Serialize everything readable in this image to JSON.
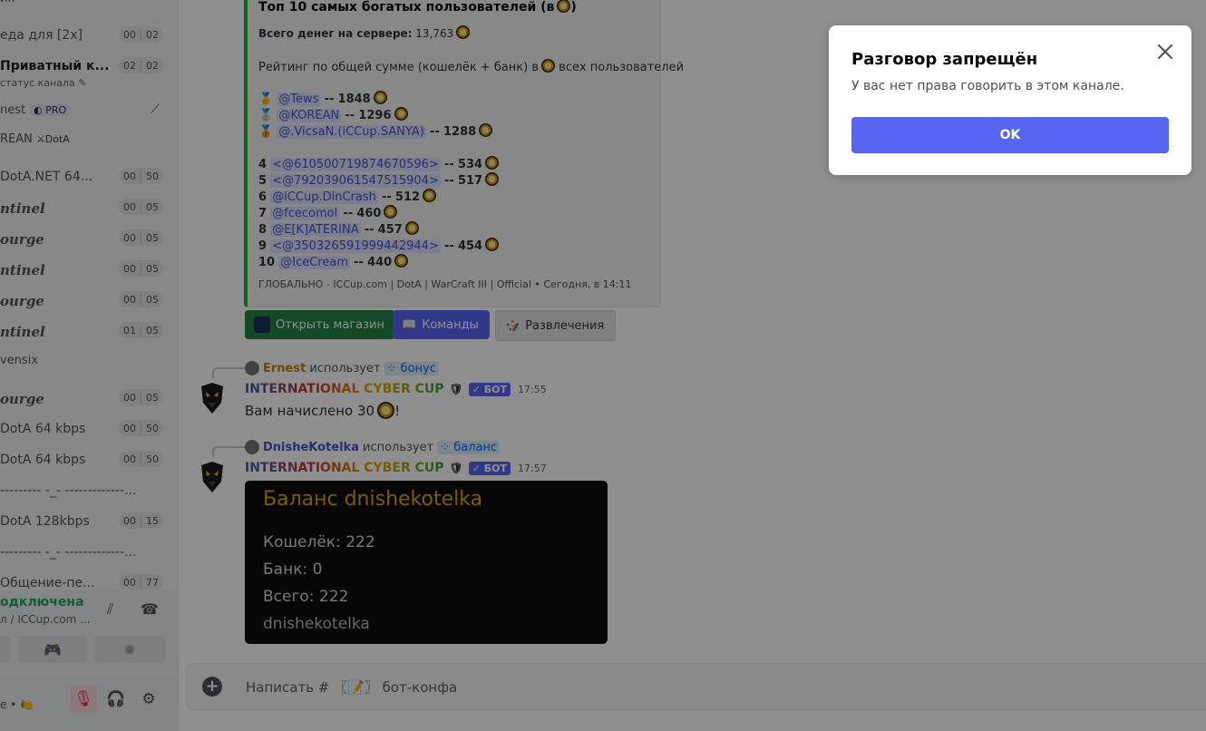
{
  "sidebar": {
    "top_clip": "ик",
    "channels": [
      {
        "name": "еда для [2x]",
        "left": "00",
        "right": "02",
        "style": "normal"
      },
      {
        "name": "Приватный к...",
        "left": "02",
        "right": "02",
        "style": "bold",
        "sub": "статус канала"
      },
      {
        "name": "DotA.NET 64...",
        "left": "00",
        "right": "50",
        "style": "normal"
      },
      {
        "name": "ntinel",
        "left": "00",
        "right": "05",
        "style": "gothic"
      },
      {
        "name": "ourge",
        "left": "00",
        "right": "05",
        "style": "gothic"
      },
      {
        "name": "ntinel",
        "left": "00",
        "right": "05",
        "style": "gothic"
      },
      {
        "name": "ourge",
        "left": "00",
        "right": "05",
        "style": "gothic"
      },
      {
        "name": "ntinel",
        "left": "01",
        "right": "05",
        "style": "gothic"
      },
      {
        "name": "ourge",
        "left": "00",
        "right": "05",
        "style": "gothic"
      },
      {
        "name": "DotA 64 kbps",
        "left": "00",
        "right": "50",
        "style": "normal"
      },
      {
        "name": "DotA 64 kbps",
        "left": "00",
        "right": "50",
        "style": "normal"
      },
      {
        "name": "--------- -_- -------------...",
        "style": "divider"
      },
      {
        "name": "DotA 128kbps",
        "left": "00",
        "right": "15",
        "style": "normal"
      },
      {
        "name": "--------- -_- -------------...",
        "style": "divider"
      },
      {
        "name": "Общение-пе...",
        "left": "00",
        "right": "77",
        "style": "normal"
      }
    ],
    "users": [
      {
        "name": "nest",
        "tag": "PRO"
      },
      {
        "name": "REAN",
        "tag": "DotA"
      },
      {
        "name": "vensix",
        "tag": ""
      }
    ],
    "voice": {
      "status": "одключена",
      "where": "л / ICCup.com ..."
    },
    "user_status": "е •"
  },
  "embed": {
    "title": "Топ 10 самых богатых пользователей (в",
    "title_end": ")",
    "total_label": "Всего денег на сервере:",
    "total_value": "13,763",
    "desc_prefix": "Рейтинг по общей сумме (кошелёк + банк) в",
    "desc_suffix": "всех пользователей",
    "top3": [
      {
        "name": "@Tews",
        "sep": "--",
        "value": "1848"
      },
      {
        "name": "@KOREAN",
        "sep": "--",
        "value": "1296"
      },
      {
        "name": "@.VicsaN.(iCCup.SANYA)",
        "sep": "--",
        "value": "1288"
      }
    ],
    "rest": [
      {
        "rank": "4",
        "name": "<@610500719874670596>",
        "sep": "--",
        "value": "534"
      },
      {
        "rank": "5",
        "name": "<@792039061547515904>",
        "sep": "--",
        "value": "517"
      },
      {
        "rank": "6",
        "name": "@iCCup.DinCrash",
        "sep": "--",
        "value": "512"
      },
      {
        "rank": "7",
        "name": "@fcecomol",
        "sep": "--",
        "value": "460"
      },
      {
        "rank": "8",
        "name": "@E[K]ATERINA",
        "sep": "--",
        "value": "457"
      },
      {
        "rank": "9",
        "name": "<@350326591999442944>",
        "sep": "--",
        "value": "454"
      },
      {
        "rank": "10",
        "name": "@IceCream",
        "sep": "--",
        "value": "440"
      }
    ],
    "footer": "ГЛОБАЛЬНО - ICCup.com | DotA | WarCraft III | Official • Сегодня, в 14:11"
  },
  "buttons": {
    "shop": "Открыть магазин",
    "commands": "Команды",
    "fun": "Развлечения"
  },
  "messages": [
    {
      "reply_user": "Ernest",
      "reply_uses": "использует",
      "reply_cmd": "бонус",
      "author": "INTERNATIONAL CYBER CUP",
      "badge": "БОТ",
      "time": "17:55",
      "text_prefix": "Вам начислено 30",
      "text_suffix": "!"
    },
    {
      "reply_user": "DnisheKotelka",
      "reply_uses": "использует",
      "reply_cmd": "баланс",
      "author": "INTERNATIONAL CYBER CUP",
      "badge": "БОТ",
      "time": "17:57"
    }
  ],
  "balance": {
    "title": "Баланс dnishekotelka",
    "wallet": "Кошелёк: 222",
    "bank": "Банк: 0",
    "total": "Всего: 222",
    "user": "dnishekotelka"
  },
  "composer": {
    "placeholder": "Написать # 〖📝〗 бот-конфа"
  },
  "modal": {
    "title": "Разговор запрещён",
    "description": "У вас нет права говорить в этом канале.",
    "ok": "OK"
  },
  "colors": {
    "accent": "#5865f2",
    "embed_bar": "#1fb31f",
    "shop_button": "#248046",
    "balance_title": "#d9a700"
  }
}
